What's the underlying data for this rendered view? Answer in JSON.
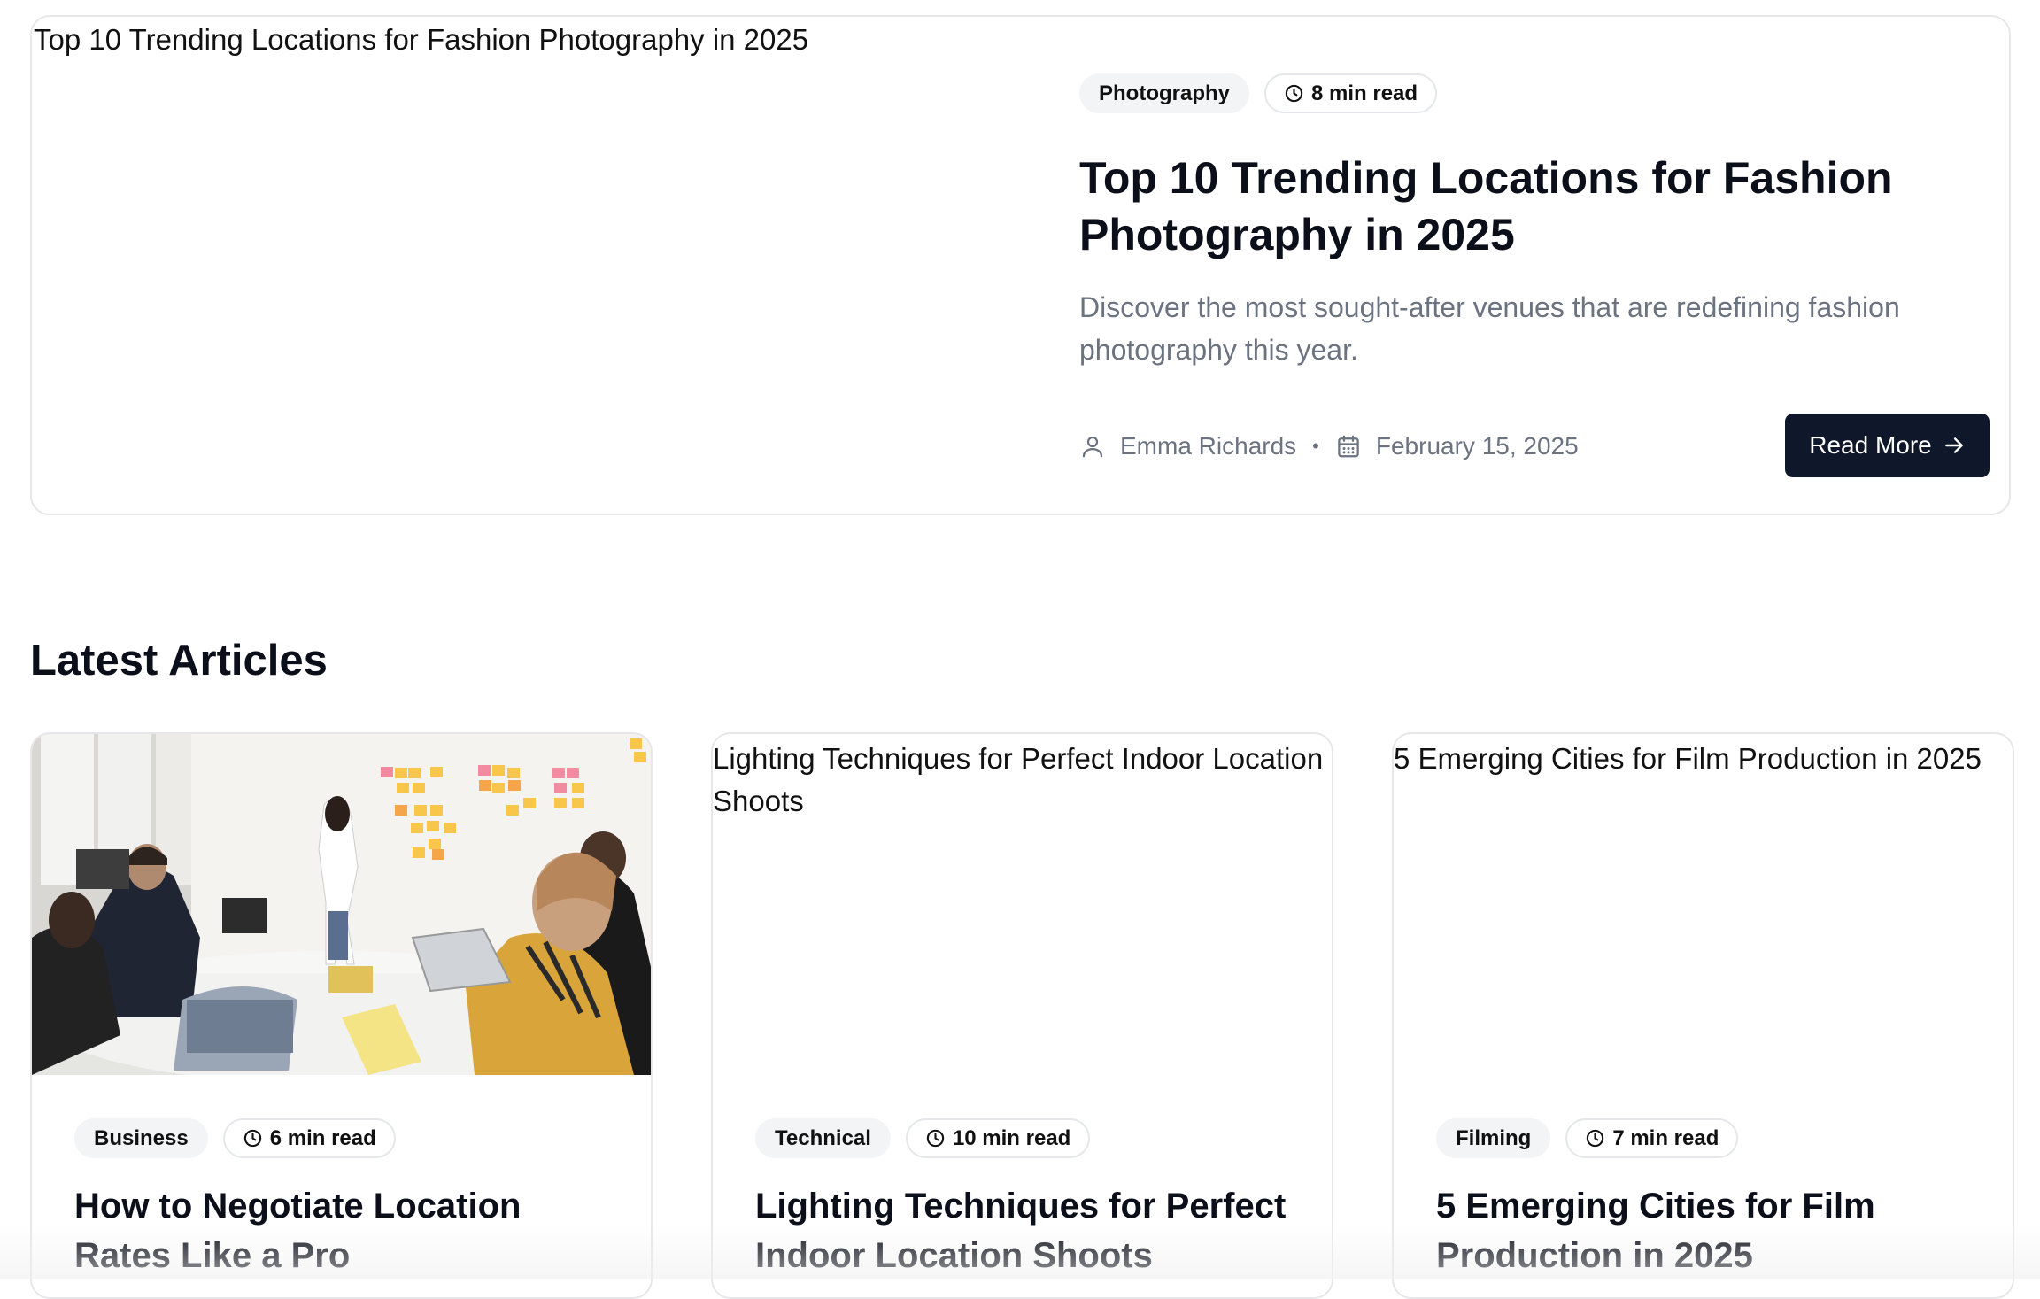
{
  "featured": {
    "image_alt": "Top 10 Trending Locations for Fashion Photography in 2025",
    "category": "Photography",
    "read_time": "8 min read",
    "title": "Top 10 Trending Locations for Fashion Photography in 2025",
    "description": "Discover the most sought-after venues that are redefining fashion photography this year.",
    "author": "Emma Richards",
    "separator": "•",
    "date": "February 15, 2025",
    "button_label": "Read More"
  },
  "latest": {
    "heading": "Latest Articles",
    "articles": [
      {
        "image_alt": "",
        "category": "Business",
        "read_time": "6 min read",
        "title": "How to Negotiate Location Rates Like a Pro"
      },
      {
        "image_alt": "Lighting Techniques for Perfect Indoor Location Shoots",
        "category": "Technical",
        "read_time": "10 min read",
        "title": "Lighting Techniques for Perfect Indoor Location Shoots"
      },
      {
        "image_alt": "5 Emerging Cities for Film Production in 2025",
        "category": "Filming",
        "read_time": "7 min read",
        "title": "5 Emerging Cities for Film Production in 2025"
      }
    ]
  },
  "icons": {
    "clock": "clock-icon",
    "user": "user-icon",
    "calendar": "calendar-icon",
    "arrow": "arrow-right-icon"
  },
  "colors": {
    "text": "#0b0f19",
    "muted": "#6b7280",
    "button_bg": "#0f172a",
    "chip_bg": "#f3f4f6",
    "border": "#e7e7ea"
  }
}
